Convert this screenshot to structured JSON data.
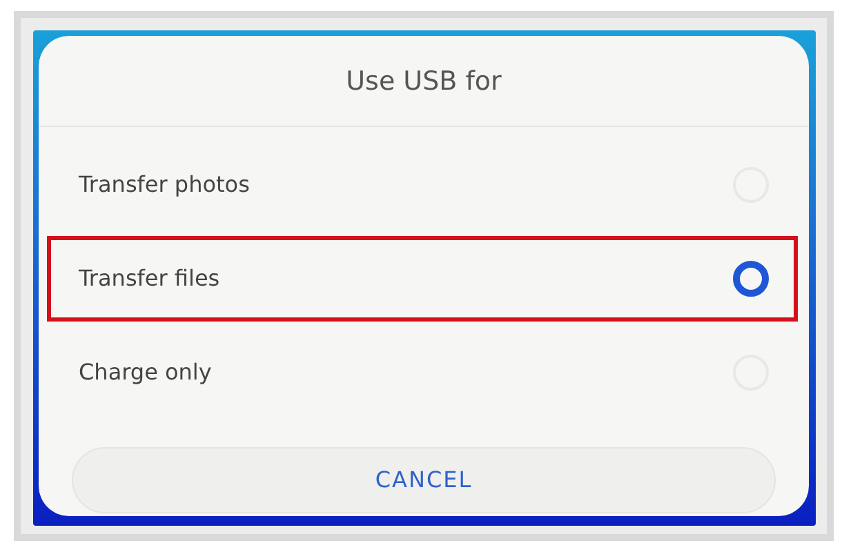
{
  "dialog": {
    "title": "Use USB for",
    "options": [
      {
        "label": "Transfer photos",
        "selected": false,
        "highlighted": false
      },
      {
        "label": "Transfer files",
        "selected": true,
        "highlighted": true
      },
      {
        "label": "Charge only",
        "selected": false,
        "highlighted": false
      }
    ],
    "buttons": [
      "CANCEL"
    ]
  }
}
